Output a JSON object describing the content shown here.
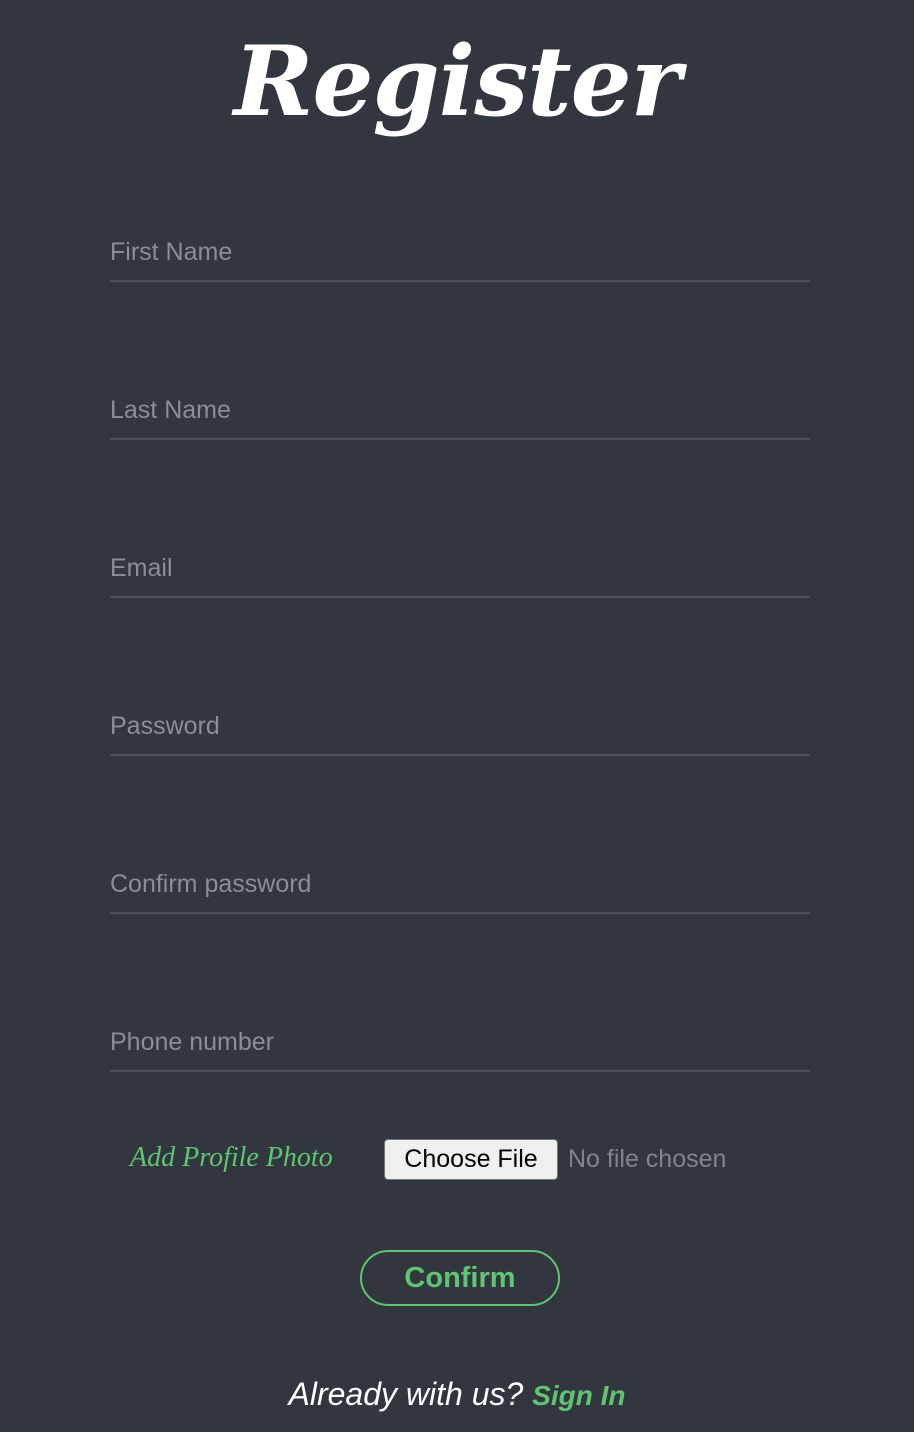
{
  "page": {
    "title": "Register"
  },
  "form": {
    "first_name_placeholder": "First Name",
    "last_name_placeholder": "Last Name",
    "email_placeholder": "Email",
    "password_placeholder": "Password",
    "confirm_password_placeholder": "Confirm password",
    "phone_placeholder": "Phone number",
    "first_name_value": "",
    "last_name_value": "",
    "email_value": "",
    "password_value": "",
    "confirm_password_value": "",
    "phone_value": ""
  },
  "photo": {
    "label": "Add Profile Photo",
    "button_label": "Choose File",
    "status": "No file chosen"
  },
  "actions": {
    "confirm_label": "Confirm"
  },
  "footer": {
    "prompt": "Already with us?",
    "signin_label": "Sign In"
  },
  "colors": {
    "background": "#31363f",
    "accent": "#5fc572",
    "underline": "#4a505d",
    "placeholder": "#8a8e95"
  }
}
